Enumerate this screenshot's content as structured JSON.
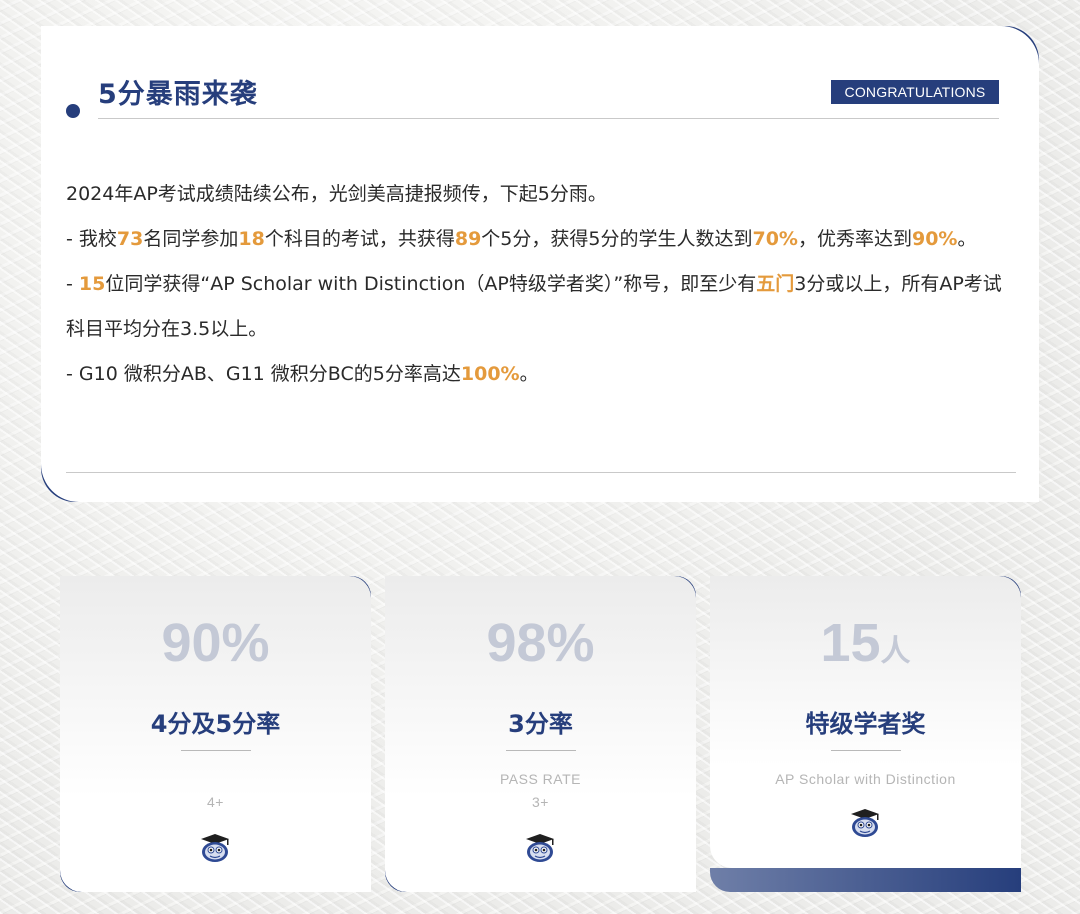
{
  "section": {
    "title": "5分暴雨来袭",
    "badge": "CONGRATULATIONS"
  },
  "body": {
    "line1": "2024年AP考试成绩陆续公布，光剑美高捷报频传，下起5分雨。",
    "p2": {
      "t1": "- 我校",
      "n1": "73",
      "t2": "名同学参加",
      "n2": "18",
      "t3": "个科目的考试，共获得",
      "n3": "89",
      "t4": "个5分，获得5分的学生人数达到",
      "n4": "70%",
      "t5": "，优秀率达到",
      "n5": "90%",
      "t6": "。"
    },
    "p3": {
      "t1": "- ",
      "n1": "15",
      "t2": "位同学获得“AP Scholar with Distinction（AP特级学者奖）”称号，即至少有",
      "n2": "五门",
      "t3": "3分或以上，所有AP考试科目平均分在3.5以上。"
    },
    "p4": {
      "t1": "- G10 微积分AB、G11 微积分BC的5分率高达",
      "n1": "100%",
      "t2": "。"
    }
  },
  "stats": [
    {
      "number": "90%",
      "unit": "",
      "label": "4分及5分率",
      "sub1": "",
      "sub2": "4+"
    },
    {
      "number": "98%",
      "unit": "",
      "label": "3分率",
      "sub1": "PASS RATE",
      "sub2": "3+"
    },
    {
      "number": "15",
      "unit": "人",
      "label": "特级学者奖",
      "sub1": "AP Scholar with Distinction",
      "sub2": ""
    }
  ],
  "icons": {
    "mascot": "graduation-mascot-icon",
    "dot": "bullet-dot-icon"
  },
  "colors": {
    "navy": "#263e7c",
    "highlight": "#e49a3c",
    "stat_number": "#c4c9d6"
  }
}
